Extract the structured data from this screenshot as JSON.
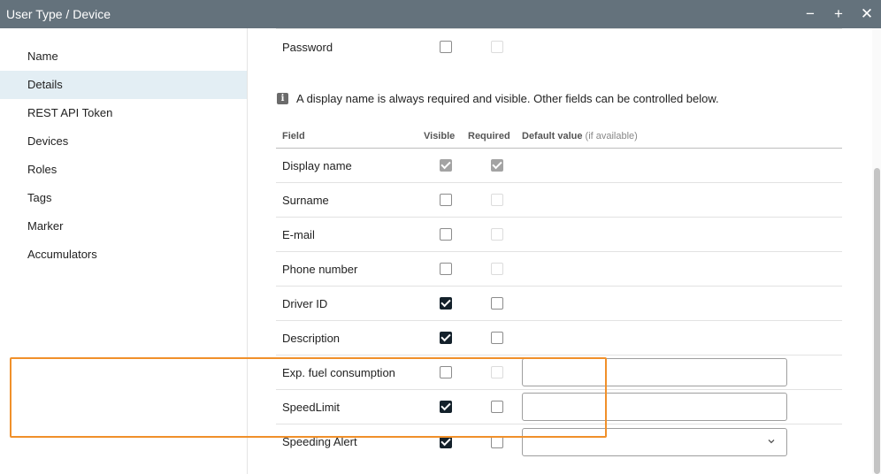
{
  "window": {
    "title": "User Type / Device",
    "minimize_label": "−",
    "maximize_label": "+",
    "close_label": "✕"
  },
  "sidebar": {
    "items": [
      {
        "label": "Name",
        "active": false
      },
      {
        "label": "Details",
        "active": true
      },
      {
        "label": "REST API Token",
        "active": false
      },
      {
        "label": "Devices",
        "active": false
      },
      {
        "label": "Roles",
        "active": false
      },
      {
        "label": "Tags",
        "active": false
      },
      {
        "label": "Marker",
        "active": false
      },
      {
        "label": "Accumulators",
        "active": false
      }
    ]
  },
  "password_row": {
    "label": "Password",
    "visible": "unchecked",
    "required": "disabled"
  },
  "info": {
    "icon": "info-icon",
    "icon_glyph": "i",
    "text": "A display name is always required and visible. Other fields can be controlled below."
  },
  "table": {
    "headers": {
      "field": "Field",
      "visible": "Visible",
      "required": "Required",
      "default_value": "Default value",
      "default_value_hint": "(if available)"
    },
    "rows": [
      {
        "field": "Display name",
        "visible": "locked",
        "required": "locked",
        "default": "none"
      },
      {
        "field": "Surname",
        "visible": "unchecked",
        "required": "disabled",
        "default": "none"
      },
      {
        "field": "E-mail",
        "visible": "unchecked",
        "required": "disabled",
        "default": "none"
      },
      {
        "field": "Phone number",
        "visible": "unchecked",
        "required": "disabled",
        "default": "none"
      },
      {
        "field": "Driver ID",
        "visible": "checked",
        "required": "unchecked",
        "default": "none"
      },
      {
        "field": "Description",
        "visible": "checked",
        "required": "unchecked",
        "default": "none"
      },
      {
        "field": "Exp. fuel consumption",
        "visible": "unchecked",
        "required": "disabled",
        "default": "input",
        "default_value": ""
      },
      {
        "field": "SpeedLimit",
        "visible": "checked",
        "required": "unchecked",
        "default": "input",
        "default_value": ""
      },
      {
        "field": "Speeding Alert",
        "visible": "checked",
        "required": "unchecked",
        "default": "select",
        "default_value": ""
      }
    ]
  },
  "colors": {
    "titlebar": "#64727c",
    "active_nav": "#e3eef4",
    "checkbox_checked": "#14212b",
    "highlight": "#f0902a"
  }
}
